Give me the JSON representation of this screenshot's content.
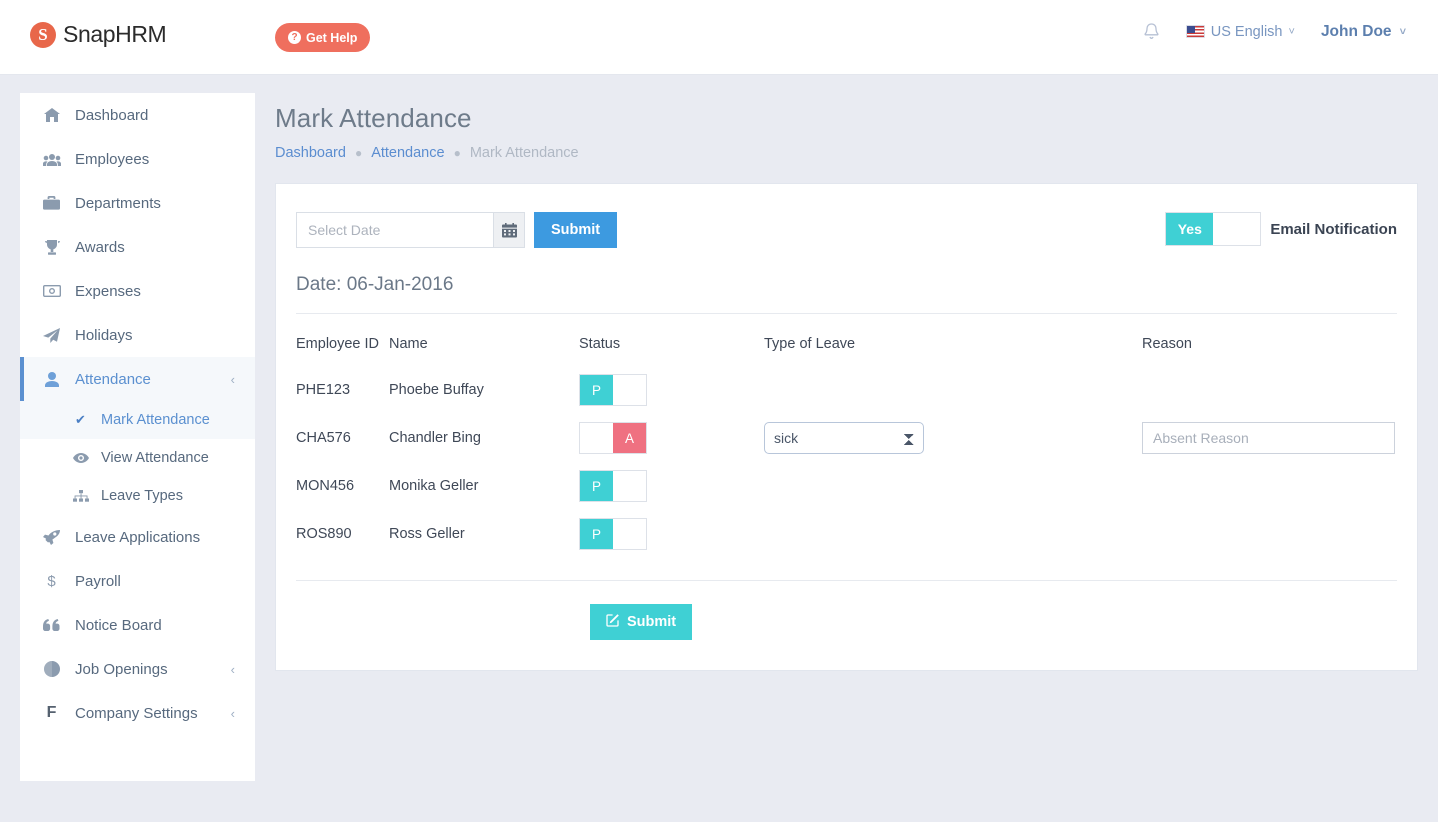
{
  "topbar": {
    "logo_text": "SnapHRM",
    "logo_letter": "S",
    "get_help_label": "Get Help",
    "help_glyph": "?",
    "bell_icon": "bell-icon",
    "language": "US English",
    "user": "John Doe",
    "caret": "⌄"
  },
  "sidebar": {
    "items": [
      {
        "label": "Dashboard",
        "icon": "🏠",
        "icon_name": "home-icon",
        "active": false,
        "chevron": ""
      },
      {
        "label": "Employees",
        "icon": "👥",
        "icon_name": "people-icon",
        "active": false,
        "chevron": ""
      },
      {
        "label": "Departments",
        "icon": "💼",
        "icon_name": "briefcase-icon",
        "active": false,
        "chevron": ""
      },
      {
        "label": "Awards",
        "icon": "🏆",
        "icon_name": "trophy-icon",
        "active": false,
        "chevron": ""
      },
      {
        "label": "Expenses",
        "icon": "💵",
        "icon_name": "money-icon",
        "active": false,
        "chevron": ""
      },
      {
        "label": "Holidays",
        "icon": "➤",
        "icon_name": "paper-plane-icon",
        "active": false,
        "chevron": ""
      },
      {
        "label": "Attendance",
        "icon": "👤",
        "icon_name": "user-icon",
        "active": true,
        "chevron": "‹"
      }
    ],
    "sub_items": [
      {
        "label": "Mark Attendance",
        "icon": "✔",
        "icon_name": "check-icon",
        "active": true
      },
      {
        "label": "View Attendance",
        "icon": "👁",
        "icon_name": "eye-icon",
        "active": false
      },
      {
        "label": "Leave Types",
        "icon": "⚙",
        "icon_name": "sitemap-icon",
        "active": false
      }
    ],
    "items_after": [
      {
        "label": "Leave Applications",
        "icon": "🚀",
        "icon_name": "rocket-icon",
        "active": false,
        "chevron": ""
      },
      {
        "label": "Payroll",
        "icon": "$",
        "icon_name": "dollar-icon",
        "active": false,
        "chevron": ""
      },
      {
        "label": "Notice Board",
        "icon": "❝",
        "icon_name": "quote-icon",
        "active": false,
        "chevron": ""
      },
      {
        "label": "Job Openings",
        "icon": "🌐",
        "icon_name": "globe-icon",
        "active": false,
        "chevron": "‹"
      },
      {
        "label": "Company Settings",
        "icon": "F",
        "icon_name": "flag-icon",
        "active": false,
        "chevron": "‹"
      }
    ]
  },
  "page": {
    "title": "Mark Attendance",
    "breadcrumb": [
      {
        "label": "Dashboard",
        "link": true
      },
      {
        "label": "Attendance",
        "link": true
      },
      {
        "label": "Mark Attendance",
        "link": false
      }
    ],
    "breadcrumb_separator": "●"
  },
  "toolbar": {
    "date_placeholder": "Select Date",
    "date_value": "",
    "calendar_icon": "📅",
    "submit_label": "Submit",
    "notification_toggle_on": "Yes",
    "notification_label": "Email Notification"
  },
  "table": {
    "date_heading": "Date: 06-Jan-2016",
    "headers": {
      "employee_id": "Employee ID",
      "name": "Name",
      "status": "Status",
      "type_of_leave": "Type of Leave",
      "reason": "Reason"
    },
    "status_present_label": "P",
    "status_absent_label": "A",
    "rows": [
      {
        "employee_id": "PHE123",
        "name": "Phoebe Buffay",
        "status": "P",
        "leave_type": null,
        "reason_placeholder": null,
        "reason_value": null
      },
      {
        "employee_id": "CHA576",
        "name": "Chandler Bing",
        "status": "A",
        "leave_type": "sick",
        "leave_options": [
          "sick"
        ],
        "reason_placeholder": "Absent Reason",
        "reason_value": ""
      },
      {
        "employee_id": "MON456",
        "name": "Monika Geller",
        "status": "P",
        "leave_type": null,
        "reason_placeholder": null,
        "reason_value": null
      },
      {
        "employee_id": "ROS890",
        "name": "Ross Geller",
        "status": "P",
        "leave_type": null,
        "reason_placeholder": null,
        "reason_value": null
      }
    ]
  },
  "footer": {
    "submit_label": "Submit",
    "submit_icon": "✎"
  },
  "colors": {
    "brand_orange": "#e8674a",
    "help_red": "#ef6f5e",
    "accent_blue": "#3d9ae0",
    "teal": "#3fd0d4",
    "red": "#ef7181",
    "link_blue": "#5b8dd0",
    "page_bg": "#e9ebf2"
  }
}
